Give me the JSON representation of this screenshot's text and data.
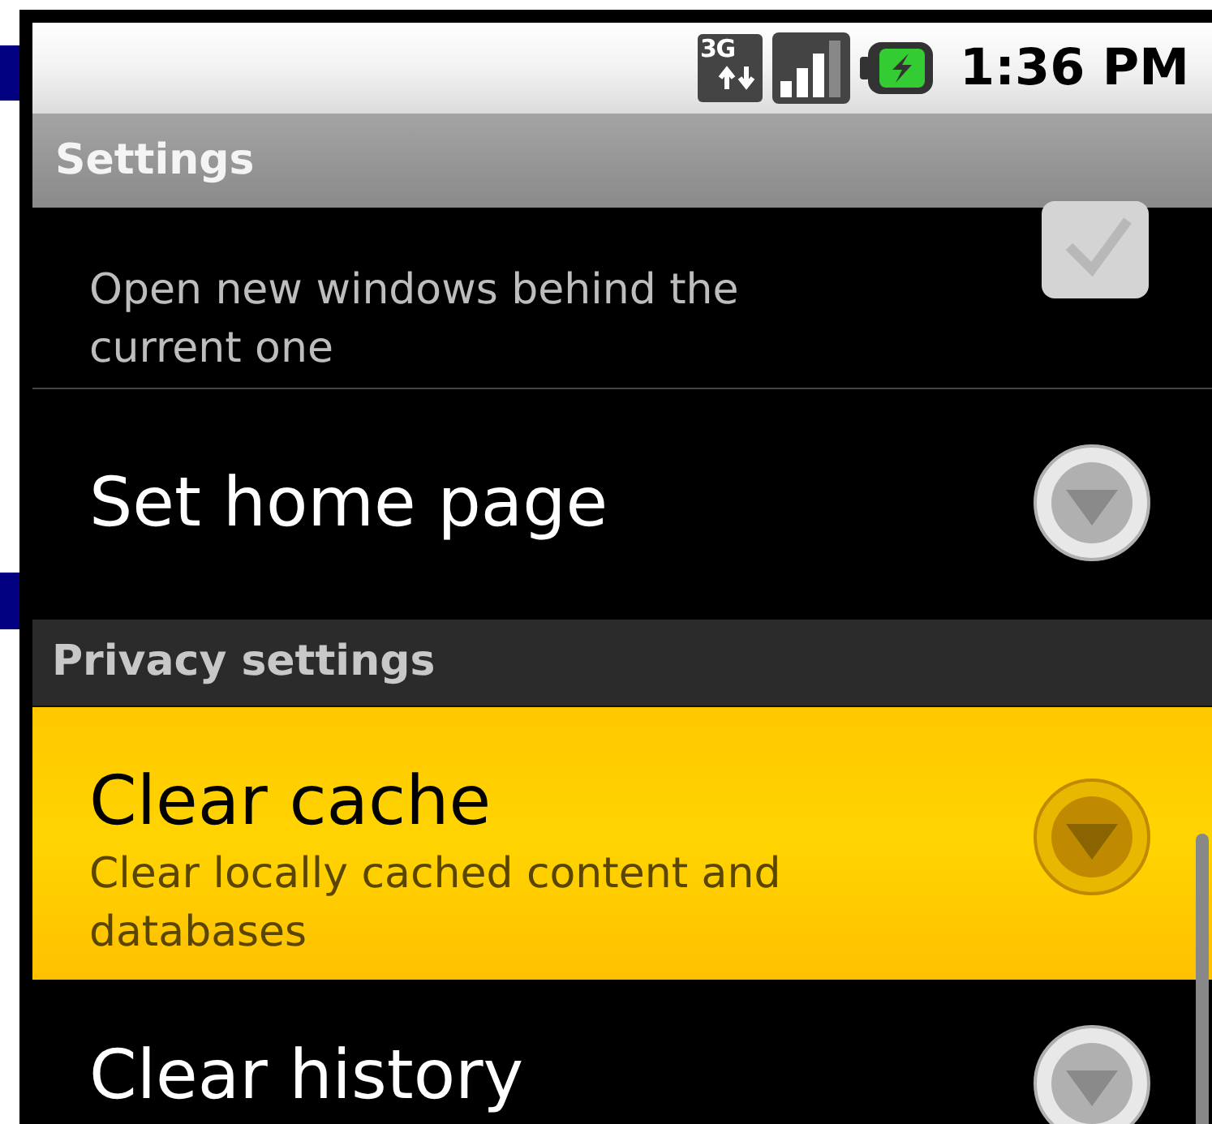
{
  "status_bar": {
    "network": "3G",
    "time": "1:36 PM"
  },
  "title": "Settings",
  "items": [
    {
      "kind": "checkbox",
      "summary": "Open new windows behind the current one",
      "checked": true,
      "selected": false
    },
    {
      "kind": "dialog",
      "title": "Set home page",
      "selected": false
    },
    {
      "kind": "category",
      "title": "Privacy settings"
    },
    {
      "kind": "dialog",
      "title": "Clear cache",
      "summary": "Clear locally cached content and databases",
      "selected": true
    },
    {
      "kind": "dialog",
      "title": "Clear history",
      "selected": false
    }
  ]
}
